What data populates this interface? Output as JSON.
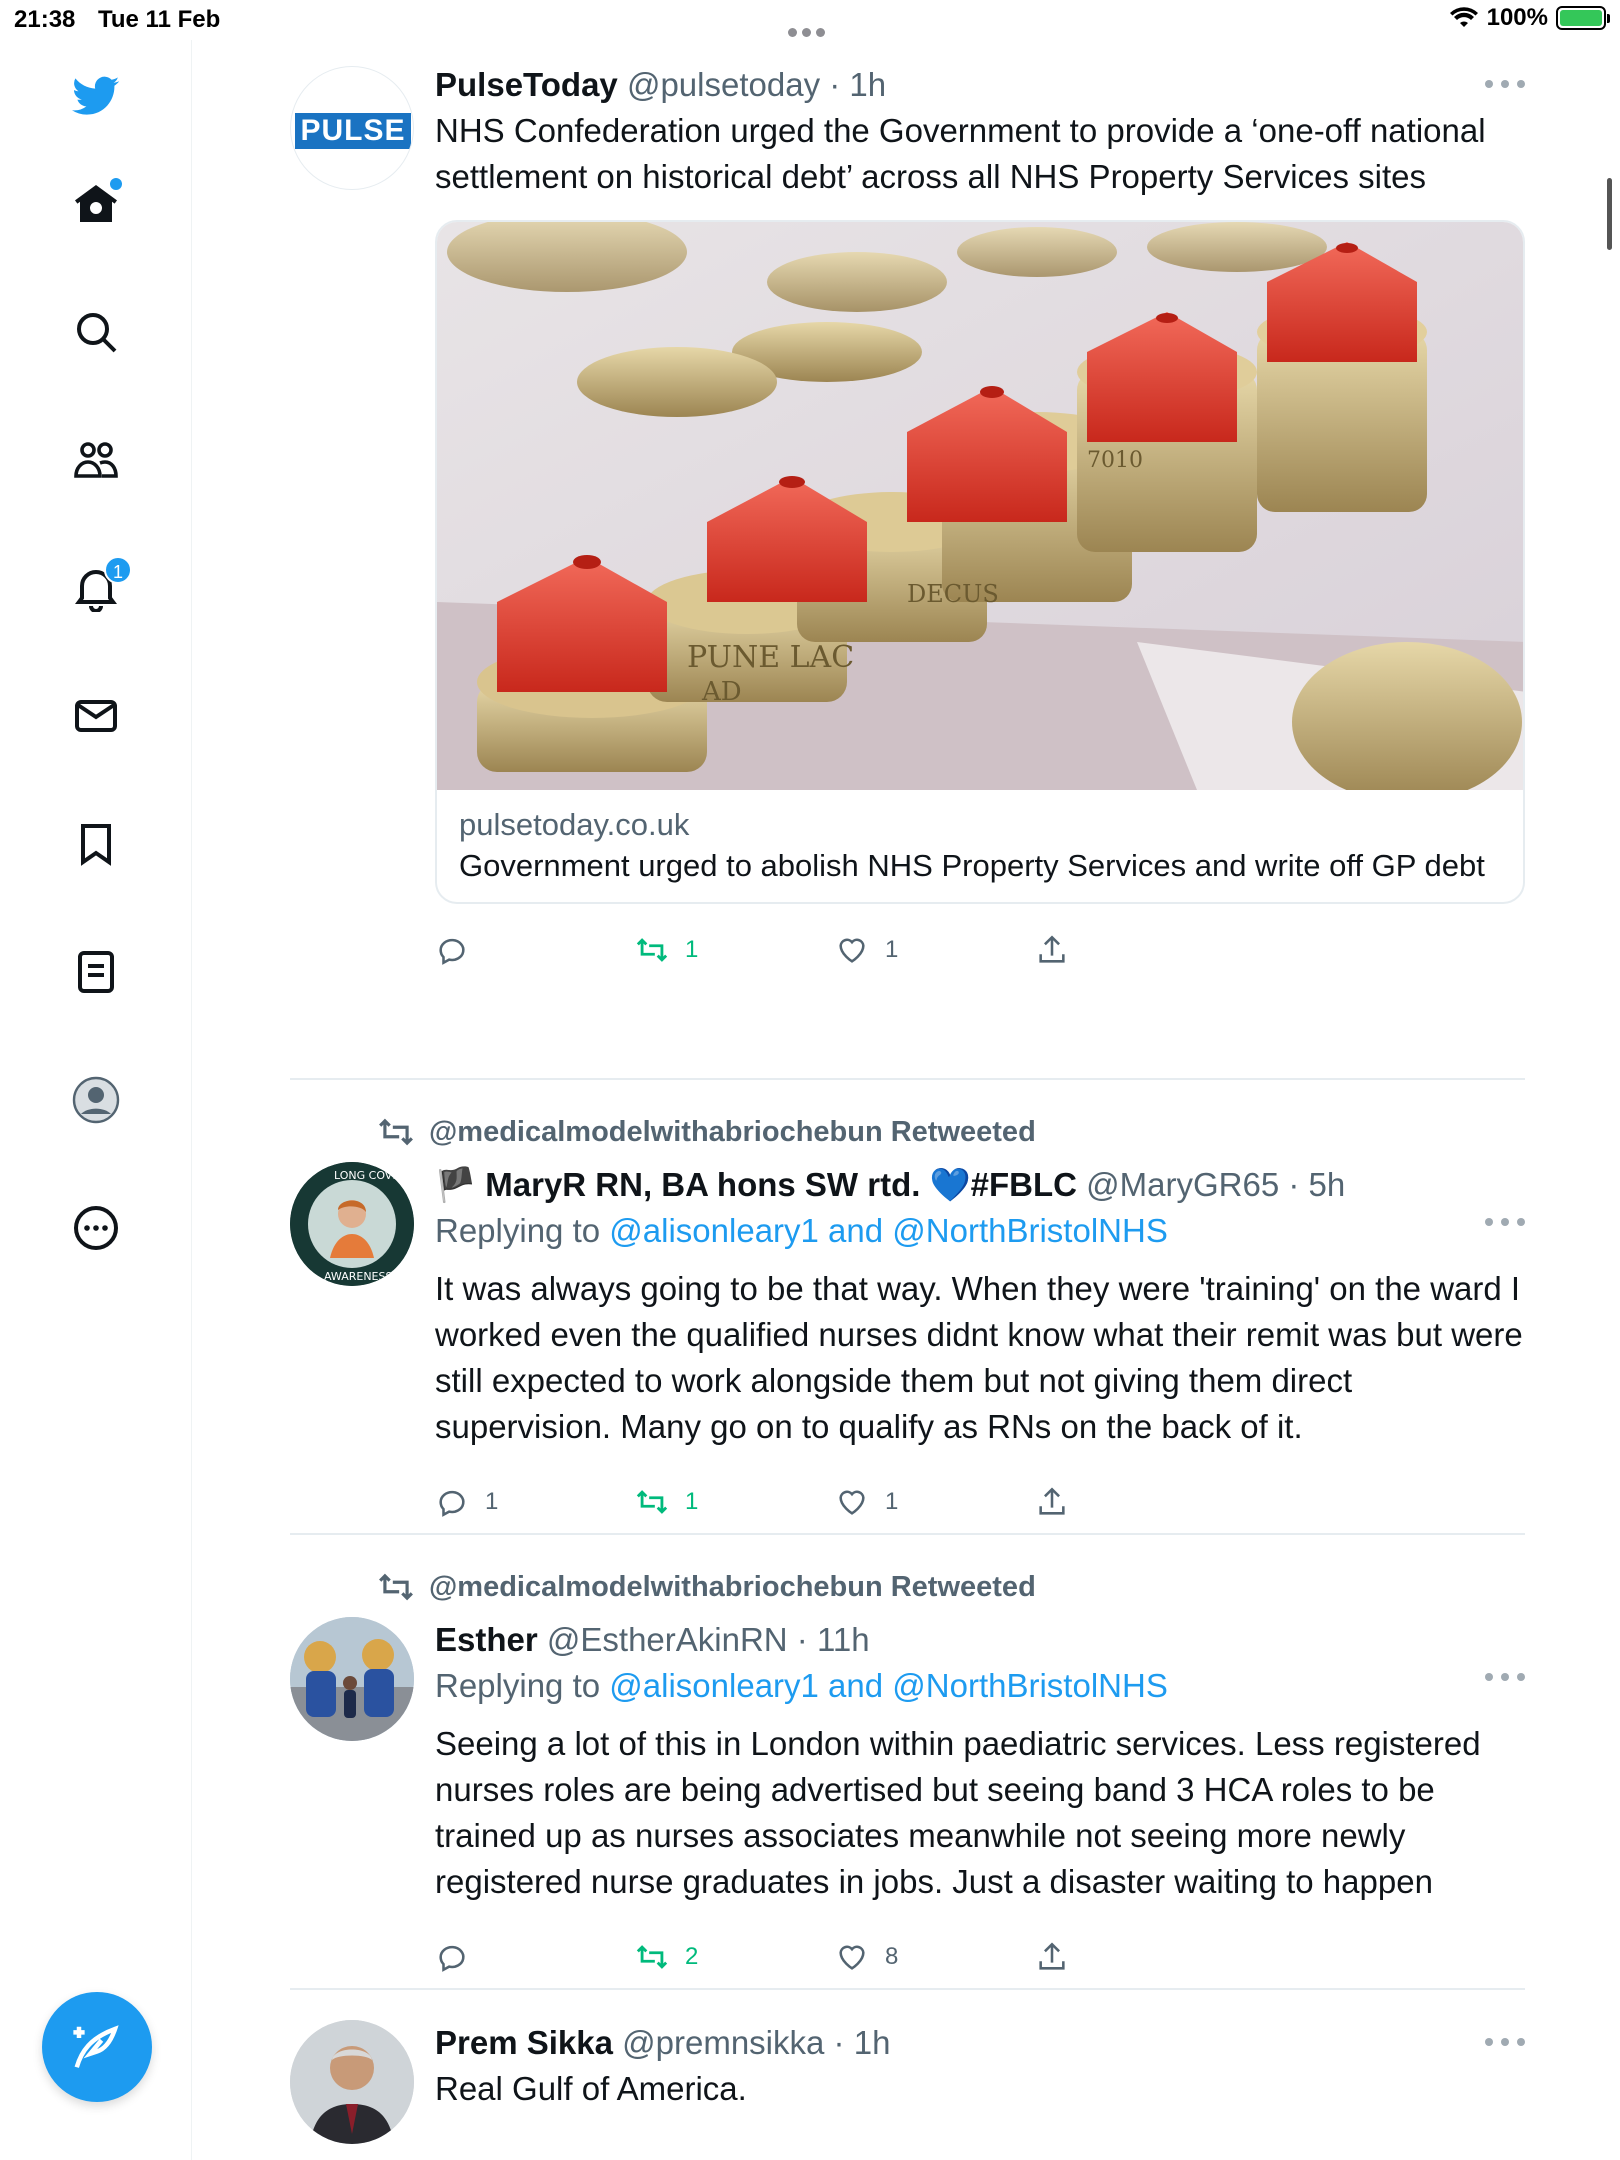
{
  "status_bar": {
    "time": "21:38",
    "date": "Tue 11 Feb",
    "battery": "100%",
    "battery_color": "#34c759"
  },
  "sidebar": {
    "accent_color": "#1d9bf0",
    "items": [
      {
        "icon": "twitter-logo-icon"
      },
      {
        "icon": "home-icon",
        "has_dot": true
      },
      {
        "icon": "search-icon"
      },
      {
        "icon": "communities-icon"
      },
      {
        "icon": "notifications-icon",
        "badge": "1"
      },
      {
        "icon": "messages-icon"
      },
      {
        "icon": "bookmarks-icon"
      },
      {
        "icon": "lists-icon"
      },
      {
        "icon": "profile-icon"
      },
      {
        "icon": "more-icon"
      }
    ],
    "compose_icon": "compose-tweet-icon"
  },
  "tweets": [
    {
      "name": "PulseToday",
      "handle": "@pulsetoday",
      "sep": "·",
      "time": "1h",
      "avatar_text": "PULSE",
      "text": "NHS Confederation urged the Government to provide a ‘one-off national settlement on historical debt’ across all NHS Property Services sites",
      "card": {
        "domain": "pulsetoday.co.uk",
        "title": "Government urged to abolish NHS Property Services and write off GP debt",
        "image_description": "red toy houses on stacks of coins",
        "coin_text_1": "PUNE LAC",
        "coin_text_2": "AD",
        "coin_text_3": "DECUS",
        "coin_text_4": "7010"
      },
      "replies": "",
      "retweets": "1",
      "likes": "1"
    },
    {
      "retweeted_by": "@medicalmodelwithabriochebun Retweeted",
      "name": "MaryR RN, BA hons SW rtd. 💙#FBLC",
      "flag": "🏴",
      "handle": "@MaryGR65",
      "sep": "·",
      "time": "5h",
      "avatar_ring_text_top": "LONG COVID",
      "avatar_ring_text_bottom": "AWARENESS",
      "reply_label": "Replying to",
      "reply_mentions": "@alisonleary1 and @NorthBristolNHS",
      "text": "It was always going to be that way. When they were 'training' on the ward I worked even the qualified nurses didnt know what their remit was but were still expected to work alongside them but not giving them direct supervision.  Many go on to qualify as RNs on the back of it.",
      "replies": "1",
      "retweets": "1",
      "likes": "1"
    },
    {
      "retweeted_by": "@medicalmodelwithabriochebun Retweeted",
      "name": "Esther",
      "handle": "@EstherAkinRN",
      "sep": "·",
      "time": "11h",
      "reply_label": "Replying to",
      "reply_mentions": "@alisonleary1 and @NorthBristolNHS",
      "text": "Seeing a lot of this in London within paediatric services. Less registered nurses roles are being advertised but seeing band 3 HCA roles to be trained up as nurses associates meanwhile not seeing more newly registered nurse graduates in jobs. Just a disaster waiting to happen",
      "replies": "",
      "retweets": "2",
      "likes": "8"
    },
    {
      "name": "Prem Sikka",
      "handle": "@premnsikka",
      "sep": "·",
      "time": "1h",
      "text": "Real Gulf of America."
    }
  ],
  "colors": {
    "retweet_green": "#00ba7c",
    "link_blue": "#1d9bf0",
    "secondary_text": "#536471"
  }
}
